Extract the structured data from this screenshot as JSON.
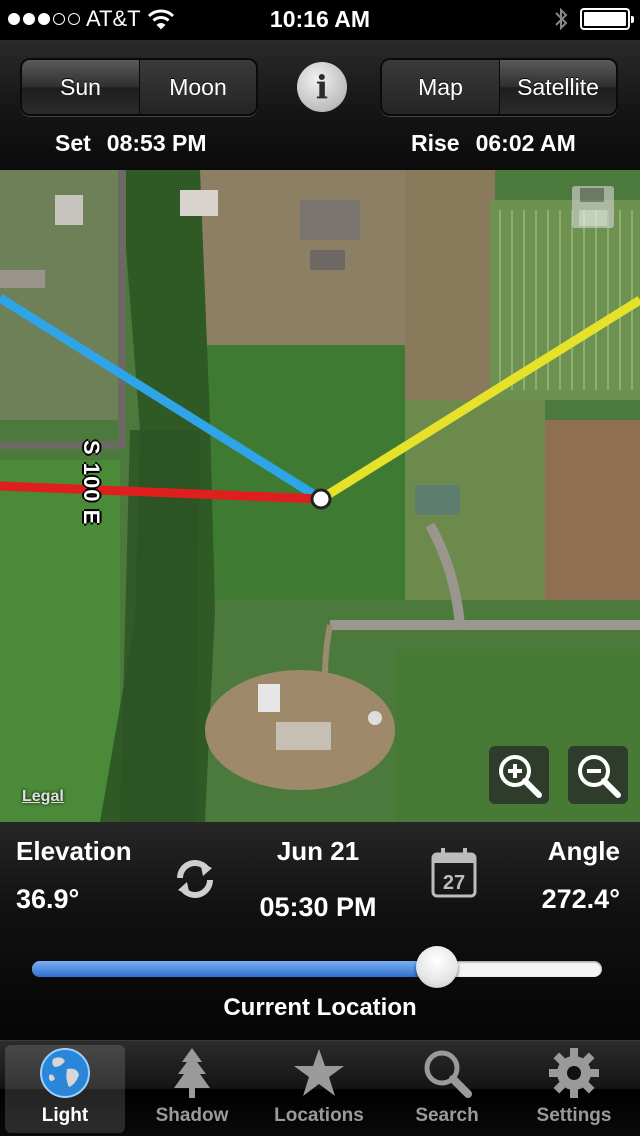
{
  "status_bar": {
    "carrier": "AT&T",
    "time": "10:16 AM",
    "signal_bars": 3,
    "signal_total": 5,
    "battery_level": 1.0
  },
  "mode_toggle": {
    "options": [
      "Sun",
      "Moon"
    ],
    "selected": "Moon"
  },
  "map_type_toggle": {
    "options": [
      "Map",
      "Satellite"
    ],
    "selected": "Satellite"
  },
  "info_button": {
    "label": "i"
  },
  "events": {
    "left": {
      "label": "Set",
      "time": "08:53 PM"
    },
    "right": {
      "label": "Rise",
      "time": "06:02 AM"
    }
  },
  "map": {
    "road_label": "S 100 E",
    "legal_label": "Legal",
    "line_colors": {
      "blue": "#2fa4e7",
      "red": "#e01e1e",
      "yellow": "#e6e22a"
    }
  },
  "readout": {
    "elevation_label": "Elevation",
    "elevation_value": "36.9°",
    "date": "Jun 21",
    "time": "05:30 PM",
    "calendar_day": "27",
    "angle_label": "Angle",
    "angle_value": "272.4°"
  },
  "time_slider": {
    "fraction": 0.71
  },
  "location_label": "Current Location",
  "tabs": [
    {
      "label": "Light",
      "icon": "globe-icon",
      "selected": true
    },
    {
      "label": "Shadow",
      "icon": "tree-icon",
      "selected": false
    },
    {
      "label": "Locations",
      "icon": "star-icon",
      "selected": false
    },
    {
      "label": "Search",
      "icon": "search-icon",
      "selected": false
    },
    {
      "label": "Settings",
      "icon": "gear-icon",
      "selected": false
    }
  ]
}
